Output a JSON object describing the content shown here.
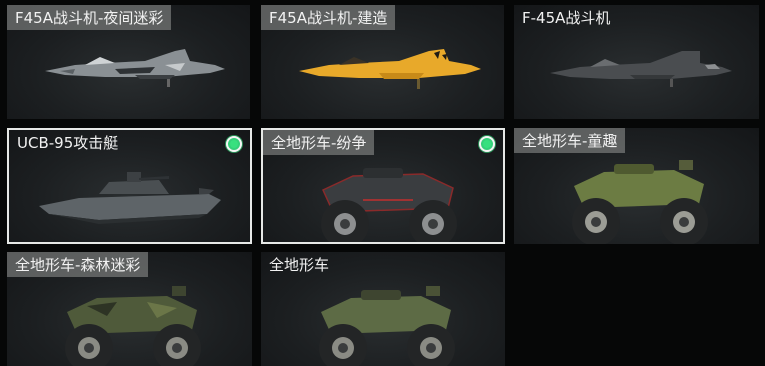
{
  "vehicles": [
    {
      "name": "F45A战斗机-夜间迷彩",
      "icon": "jet-night-camo-icon",
      "selected": false,
      "equipped": false
    },
    {
      "name": "F45A战斗机-建造",
      "icon": "jet-construction-icon",
      "selected": false,
      "equipped": false
    },
    {
      "name": "F-45A战斗机",
      "icon": "jet-icon",
      "selected": false,
      "equipped": false
    },
    {
      "name": "UCB-95攻击艇",
      "icon": "attack-boat-icon",
      "selected": true,
      "equipped": true
    },
    {
      "name": "全地形车-纷争",
      "icon": "atv-strife-icon",
      "selected": true,
      "equipped": true
    },
    {
      "name": "全地形车-童趣",
      "icon": "atv-childlike-icon",
      "selected": false,
      "equipped": false
    },
    {
      "name": "全地形车-森林迷彩",
      "icon": "atv-forest-camo-icon",
      "selected": false,
      "equipped": false
    },
    {
      "name": "全地形车",
      "icon": "atv-icon",
      "selected": false,
      "equipped": false
    }
  ],
  "colors": {
    "equipped_badge": "#35d07a",
    "selected_border": "#e6e8e6",
    "jet_night": "#9aa0a4",
    "jet_construction": "#e8a92a",
    "jet_plain": "#4a4d50",
    "boat": "#5e6468",
    "atv_strife": "#3a3d40",
    "atv_childlike": "#6c7c43",
    "atv_forest": "#4f5a3a",
    "atv_plain": "#5d6b45"
  }
}
